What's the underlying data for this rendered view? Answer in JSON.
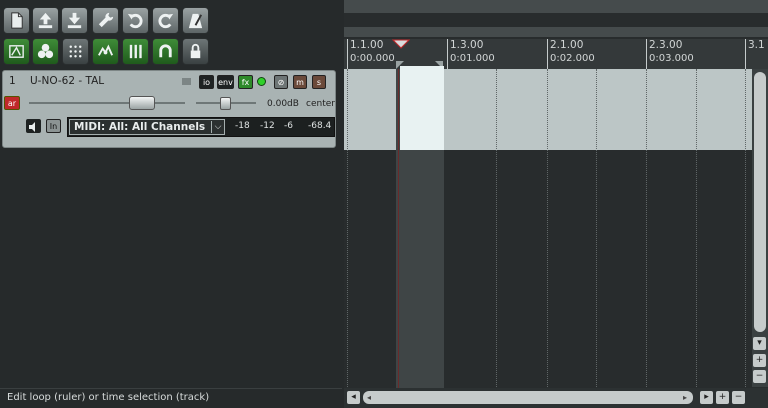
{
  "toolbar": {
    "row1": [
      "new-project-icon",
      "save-upload-icon",
      "save-download-icon",
      "wrench-icon",
      "undo-icon",
      "redo-icon",
      "metronome-icon"
    ],
    "row2": [
      "grid-snap-icon",
      "ripple-icon",
      "grid-dots-icon",
      "envelope-icon",
      "bars-icon",
      "loop-icon",
      "lock-icon"
    ]
  },
  "track": {
    "number": "1",
    "name": "U-NO-62 - TAL",
    "arm_label": "ar",
    "io_label": "io",
    "env_label": "env",
    "fx_label": "fx",
    "mute_label": "m",
    "solo_label": "s",
    "pan_readout": "0.00dB",
    "pan_mode": "center",
    "input_select": "MIDI: All: All Channels",
    "meter_ticks": [
      "-18",
      "-12",
      "-6",
      "-68.4"
    ],
    "in_label": "In"
  },
  "status_text": "Edit loop (ruler) or time selection (track)",
  "ruler": {
    "markers": [
      {
        "bar": "1.1.00",
        "time": "0:00.000"
      },
      {
        "bar": "1.3.00",
        "time": "0:01.000"
      },
      {
        "bar": "2.1.00",
        "time": "0:02.000"
      },
      {
        "bar": "2.3.00",
        "time": "0:03.000"
      },
      {
        "bar": "3.1",
        "time": ""
      }
    ]
  },
  "colors": {
    "bg": "#262a2b",
    "track_bg": "#a9b3b3",
    "fx_green": "#2e8a2a",
    "arm_red": "#c0282a",
    "lane": "#bcc6c6"
  }
}
